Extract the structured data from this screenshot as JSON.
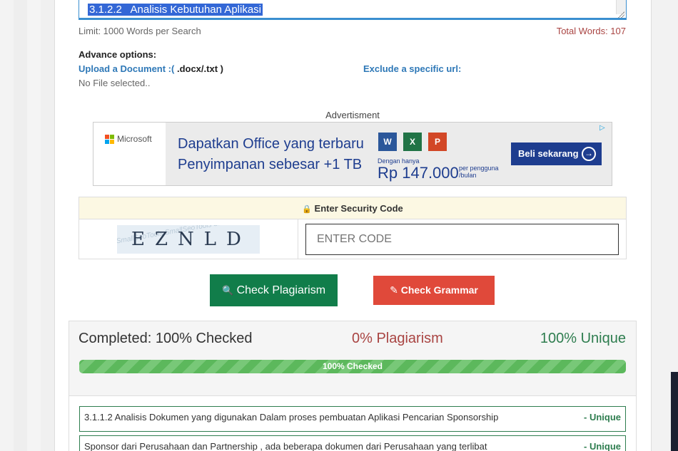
{
  "editor": {
    "selected_text": "3.1.2.2   Analisis Kebutuhan Aplikasi"
  },
  "meta": {
    "limit": "Limit: 1000 Words per Search",
    "total": "Total Words: 107"
  },
  "advance": {
    "title": "Advance options:",
    "upload_label": "Upload a Document :(",
    "upload_ext": " .docx/.txt )",
    "no_file": "No File selected..",
    "exclude_label": "Exclude a specific url:"
  },
  "ad": {
    "label": "Advertisment",
    "brand": "Microsoft",
    "line1": "Dapatkan Office yang terbaru",
    "line2": "Penyimpanan sebesar +1 TB",
    "app_word": "W",
    "app_excel": "X",
    "app_ppt": "P",
    "small": "Dengan hanya",
    "price": "Rp 147.000",
    "per1": "per pengguna",
    "per2": "/bulan",
    "cta": "Beli sekarang",
    "cta_icon": "→",
    "adchoice_icon": "▷",
    "colors": {
      "ms_red": "#f25022",
      "ms_green": "#7fba00",
      "ms_blue": "#00a4ef",
      "ms_yellow": "#ffb900",
      "word": "#2b579a",
      "excel": "#217346",
      "ppt": "#d24726"
    }
  },
  "security": {
    "lock_icon": "🔒",
    "title": "Enter Security Code",
    "captcha_code": "EZNLD",
    "captcha_noise": "SmallSeoTools SmallSeoTools SmallSeoTools",
    "input_placeholder": "ENTER CODE"
  },
  "actions": {
    "plagiarism_icon": "🔍",
    "plagiarism": "Check Plagiarism",
    "grammar_icon": "✎",
    "grammar": "Check Grammar",
    "colors": {
      "plagiarism": "#117d4a",
      "grammar": "#e0493a"
    }
  },
  "results": {
    "completed": "Completed: 100% Checked",
    "plagiarism": "0% Plagiarism",
    "unique": "100% Unique",
    "progress_label": "100% Checked",
    "progress_value": 100,
    "rows": [
      {
        "text": "3.1.1.2 Analisis Dokumen yang digunakan Dalam proses pembuatan Aplikasi Pencarian Sponsorship",
        "tag": "- Unique"
      },
      {
        "text": "Sponsor dari Perusahaan dan Partnership , ada beberapa dokumen dari Perusahaan yang terlibat",
        "tag": "- Unique"
      }
    ]
  }
}
